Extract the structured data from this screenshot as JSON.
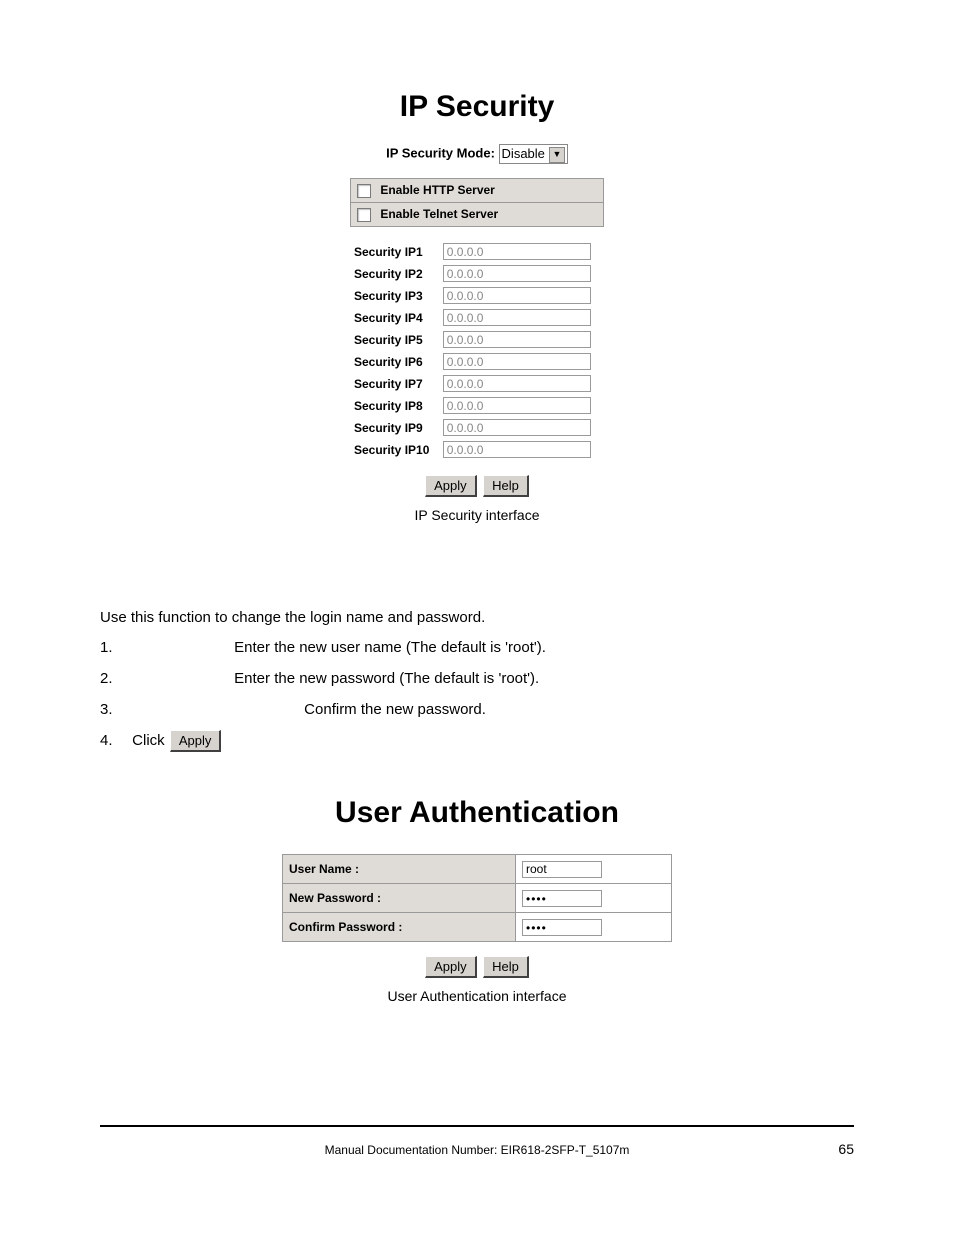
{
  "section1": {
    "heading": "IP Security",
    "mode_label": "IP Security Mode:",
    "mode_value": "Disable",
    "enable_http": "Enable HTTP Server",
    "enable_telnet": "Enable Telnet Server",
    "ip_rows": [
      {
        "label": "Security IP1",
        "value": "0.0.0.0"
      },
      {
        "label": "Security IP2",
        "value": "0.0.0.0"
      },
      {
        "label": "Security IP3",
        "value": "0.0.0.0"
      },
      {
        "label": "Security IP4",
        "value": "0.0.0.0"
      },
      {
        "label": "Security IP5",
        "value": "0.0.0.0"
      },
      {
        "label": "Security IP6",
        "value": "0.0.0.0"
      },
      {
        "label": "Security IP7",
        "value": "0.0.0.0"
      },
      {
        "label": "Security IP8",
        "value": "0.0.0.0"
      },
      {
        "label": "Security IP9",
        "value": "0.0.0.0"
      },
      {
        "label": "Security IP10",
        "value": "0.0.0.0"
      }
    ],
    "apply": "Apply",
    "help": "Help",
    "caption": "IP Security interface"
  },
  "instructions": {
    "intro": "Use this function to change the login name and password.",
    "items": [
      "Enter the new user name (The default is 'root').",
      "Enter the new password (The default is 'root').",
      "Confirm the new password."
    ],
    "click_prefix": "Click",
    "click_btn": "Apply"
  },
  "section2": {
    "heading": "User Authentication",
    "username_label": "User Name :",
    "username_value": "root",
    "newpw_label": "New Password :",
    "newpw_value": "••••",
    "confpw_label": "Confirm Password :",
    "confpw_value": "••••",
    "apply": "Apply",
    "help": "Help",
    "caption": "User Authentication interface"
  },
  "footer": {
    "doc": "Manual Documentation Number: EIR618-2SFP-T_5107m",
    "page": "65"
  }
}
